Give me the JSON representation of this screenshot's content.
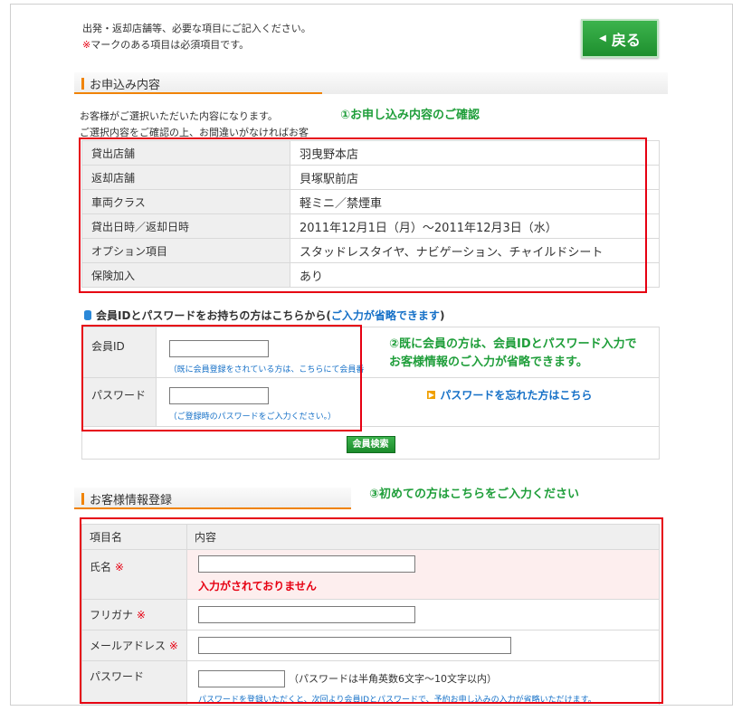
{
  "intro": {
    "line1": "出発・返却店舗等、必要な項目にご記入ください。",
    "req_mark": "※",
    "line2_rest": "マークのある項目は必須項目です。"
  },
  "back_button": {
    "label": "戻る"
  },
  "section1": {
    "title": "お申込み内容",
    "note1": "お客様がご選択いただいた内容になります。",
    "note2": "ご選択内容をご確認の上、お間違いがなければお客"
  },
  "annotations": {
    "a1": "①お申し込み内容のご確認",
    "a2_line1": "②既に会員の方は、会員IDとパスワード入力で",
    "a2_line2": "お客様情報のご入力が省略できます。",
    "a3": "③初めての方はこちらをご入力ください"
  },
  "reservation": [
    {
      "label": "貸出店舗",
      "value": "羽曳野本店"
    },
    {
      "label": "返却店舗",
      "value": "貝塚駅前店"
    },
    {
      "label": "車両クラス",
      "value": "軽ミニ／禁煙車"
    },
    {
      "label": "貸出日時／返却日時",
      "value": "2011年12月1日（月）～2011年12月3日（水）"
    },
    {
      "label": "オプション項目",
      "value": "スタッドレスタイヤ、ナビゲーション、チャイルドシート"
    },
    {
      "label": "保険加入",
      "value": "あり"
    }
  ],
  "member": {
    "heading_pre": "会員IDとパスワードをお持ちの方はこちらから(",
    "heading_link": "ご入力が省略できます",
    "heading_post": ")",
    "id_label": "会員ID",
    "id_hint": "（既に会員登録をされている方は、こちらにて会員番",
    "pw_label": "パスワード",
    "pw_hint": "（ご登録時のパスワードをご入力ください。）",
    "forgot_icon": "arrow-right-icon",
    "forgot_link": "パスワードを忘れた方はこちら",
    "search_button": "会員検索"
  },
  "section2": {
    "title": "お客様情報登録",
    "col_item": "項目名",
    "col_content": "内容",
    "name_label": "氏名",
    "name_error": "入力がされておりません",
    "kana_label": "フリガナ",
    "email_label": "メールアドレス",
    "password_label": "パスワード",
    "password_note": "（パスワードは半角英数6文字～10文字以内）",
    "password_hint": "パスワードを登録いただくと、次回より会員IDとパスワードで、予約お申し込みの入力が省略いただけます。",
    "req_mark": "※"
  },
  "colors": {
    "accent": "#f08300",
    "required": "#e60012",
    "annotation": "#1f9e3a",
    "button": "#2aa23c",
    "link": "#1570c7"
  }
}
